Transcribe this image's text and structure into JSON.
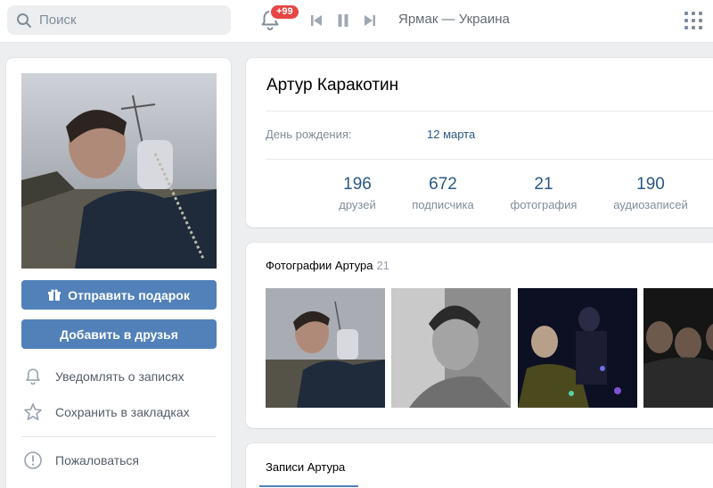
{
  "header": {
    "search_placeholder": "Поиск",
    "notifications_badge": "+99",
    "track_title": "Ярмак — Украина"
  },
  "sidebar": {
    "gift_button": "Отправить подарок",
    "add_friend_button": "Добавить в друзья",
    "menu": [
      {
        "label": "Уведомлять о записях",
        "icon": "bell-icon"
      },
      {
        "label": "Сохранить в закладках",
        "icon": "star-icon"
      },
      {
        "label": "Пожаловаться",
        "icon": "exclamation-icon"
      }
    ]
  },
  "profile": {
    "name": "Артур Каракотин",
    "birthday_label": "День рождения:",
    "birthday_value": "12 марта",
    "counters": [
      {
        "value": "196",
        "label": "друзей"
      },
      {
        "value": "672",
        "label": "подписчика"
      },
      {
        "value": "21",
        "label": "фотография"
      },
      {
        "value": "190",
        "label": "аудиозаписей"
      }
    ]
  },
  "photos": {
    "title": "Фотографии Артура",
    "count": "21"
  },
  "wall": {
    "tab_label": "Записи Артура"
  },
  "colors": {
    "accent": "#5181b8",
    "link": "#2a5885",
    "badge": "#e64646",
    "background": "#edeef0"
  }
}
